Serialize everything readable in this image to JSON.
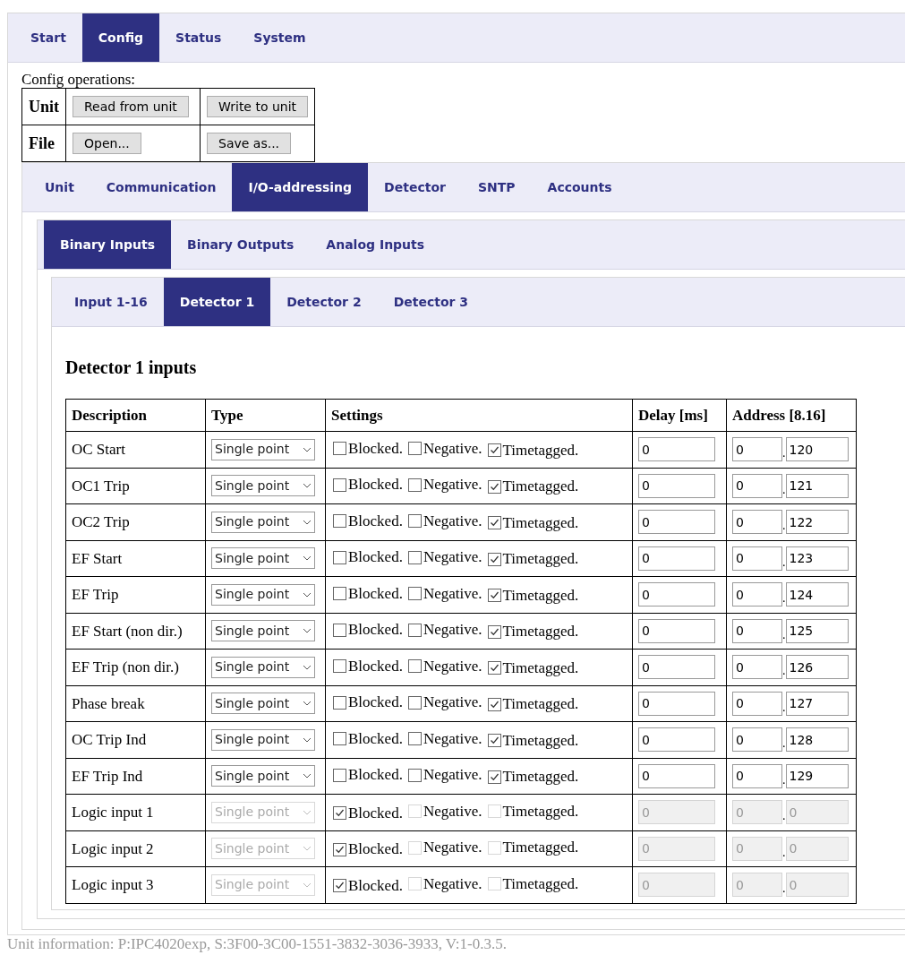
{
  "main_tabs": [
    {
      "label": "Start",
      "selected": false
    },
    {
      "label": "Config",
      "selected": true
    },
    {
      "label": "Status",
      "selected": false
    },
    {
      "label": "System",
      "selected": false
    }
  ],
  "config_operations": {
    "title": "Config operations:",
    "rows": [
      {
        "label": "Unit",
        "buttons": [
          "Read from unit",
          "Write to unit"
        ]
      },
      {
        "label": "File",
        "buttons": [
          "Open...",
          "Save as..."
        ]
      }
    ]
  },
  "config_tabs": [
    {
      "label": "Unit",
      "selected": false
    },
    {
      "label": "Communication",
      "selected": false
    },
    {
      "label": "I/O-addressing",
      "selected": true
    },
    {
      "label": "Detector",
      "selected": false
    },
    {
      "label": "SNTP",
      "selected": false
    },
    {
      "label": "Accounts",
      "selected": false
    }
  ],
  "io_tabs": [
    {
      "label": "Binary Inputs",
      "selected": true
    },
    {
      "label": "Binary Outputs",
      "selected": false
    },
    {
      "label": "Analog Inputs",
      "selected": false
    }
  ],
  "input_tabs": [
    {
      "label": "Input 1-16",
      "selected": false
    },
    {
      "label": "Detector 1",
      "selected": true
    },
    {
      "label": "Detector 2",
      "selected": false
    },
    {
      "label": "Detector 3",
      "selected": false
    }
  ],
  "section_title": "Detector 1 inputs",
  "table": {
    "columns": [
      "Description",
      "Type",
      "Settings",
      "Delay [ms]",
      "Address [8.16]"
    ],
    "rows": [
      {
        "description": "OC Start",
        "type": "Single point",
        "disabled": false,
        "settings": [
          {
            "label": "Blocked.",
            "checked": false,
            "disabled": false
          },
          {
            "label": "Negative.",
            "checked": false,
            "disabled": false
          },
          {
            "label": "Timetagged.",
            "checked": true,
            "disabled": false
          }
        ],
        "delay": "0",
        "address": {
          "high": "0",
          "separator": ".",
          "low": "120"
        }
      },
      {
        "description": "OC1 Trip",
        "type": "Single point",
        "disabled": false,
        "settings": [
          {
            "label": "Blocked.",
            "checked": false,
            "disabled": false
          },
          {
            "label": "Negative.",
            "checked": false,
            "disabled": false
          },
          {
            "label": "Timetagged.",
            "checked": true,
            "disabled": false
          }
        ],
        "delay": "0",
        "address": {
          "high": "0",
          "separator": ".",
          "low": "121"
        }
      },
      {
        "description": "OC2 Trip",
        "type": "Single point",
        "disabled": false,
        "settings": [
          {
            "label": "Blocked.",
            "checked": false,
            "disabled": false
          },
          {
            "label": "Negative.",
            "checked": false,
            "disabled": false
          },
          {
            "label": "Timetagged.",
            "checked": true,
            "disabled": false
          }
        ],
        "delay": "0",
        "address": {
          "high": "0",
          "separator": ".",
          "low": "122"
        }
      },
      {
        "description": "EF Start",
        "type": "Single point",
        "disabled": false,
        "settings": [
          {
            "label": "Blocked.",
            "checked": false,
            "disabled": false
          },
          {
            "label": "Negative.",
            "checked": false,
            "disabled": false
          },
          {
            "label": "Timetagged.",
            "checked": true,
            "disabled": false
          }
        ],
        "delay": "0",
        "address": {
          "high": "0",
          "separator": ".",
          "low": "123"
        }
      },
      {
        "description": "EF Trip",
        "type": "Single point",
        "disabled": false,
        "settings": [
          {
            "label": "Blocked.",
            "checked": false,
            "disabled": false
          },
          {
            "label": "Negative.",
            "checked": false,
            "disabled": false
          },
          {
            "label": "Timetagged.",
            "checked": true,
            "disabled": false
          }
        ],
        "delay": "0",
        "address": {
          "high": "0",
          "separator": ".",
          "low": "124"
        }
      },
      {
        "description": "EF Start (non dir.)",
        "type": "Single point",
        "disabled": false,
        "settings": [
          {
            "label": "Blocked.",
            "checked": false,
            "disabled": false
          },
          {
            "label": "Negative.",
            "checked": false,
            "disabled": false
          },
          {
            "label": "Timetagged.",
            "checked": true,
            "disabled": false
          }
        ],
        "delay": "0",
        "address": {
          "high": "0",
          "separator": ".",
          "low": "125"
        }
      },
      {
        "description": "EF Trip (non dir.)",
        "type": "Single point",
        "disabled": false,
        "settings": [
          {
            "label": "Blocked.",
            "checked": false,
            "disabled": false
          },
          {
            "label": "Negative.",
            "checked": false,
            "disabled": false
          },
          {
            "label": "Timetagged.",
            "checked": true,
            "disabled": false
          }
        ],
        "delay": "0",
        "address": {
          "high": "0",
          "separator": ".",
          "low": "126"
        }
      },
      {
        "description": "Phase break",
        "type": "Single point",
        "disabled": false,
        "settings": [
          {
            "label": "Blocked.",
            "checked": false,
            "disabled": false
          },
          {
            "label": "Negative.",
            "checked": false,
            "disabled": false
          },
          {
            "label": "Timetagged.",
            "checked": true,
            "disabled": false
          }
        ],
        "delay": "0",
        "address": {
          "high": "0",
          "separator": ".",
          "low": "127"
        }
      },
      {
        "description": "OC Trip Ind",
        "type": "Single point",
        "disabled": false,
        "settings": [
          {
            "label": "Blocked.",
            "checked": false,
            "disabled": false
          },
          {
            "label": "Negative.",
            "checked": false,
            "disabled": false
          },
          {
            "label": "Timetagged.",
            "checked": true,
            "disabled": false
          }
        ],
        "delay": "0",
        "address": {
          "high": "0",
          "separator": ".",
          "low": "128"
        }
      },
      {
        "description": "EF Trip Ind",
        "type": "Single point",
        "disabled": false,
        "settings": [
          {
            "label": "Blocked.",
            "checked": false,
            "disabled": false
          },
          {
            "label": "Negative.",
            "checked": false,
            "disabled": false
          },
          {
            "label": "Timetagged.",
            "checked": true,
            "disabled": false
          }
        ],
        "delay": "0",
        "address": {
          "high": "0",
          "separator": ".",
          "low": "129"
        }
      },
      {
        "description": "Logic input 1",
        "type": "Single point",
        "disabled": true,
        "settings": [
          {
            "label": "Blocked.",
            "checked": true,
            "disabled": false
          },
          {
            "label": "Negative.",
            "checked": false,
            "disabled": true
          },
          {
            "label": "Timetagged.",
            "checked": false,
            "disabled": true
          }
        ],
        "delay": "0",
        "address": {
          "high": "0",
          "separator": ".",
          "low": "0"
        }
      },
      {
        "description": "Logic input 2",
        "type": "Single point",
        "disabled": true,
        "settings": [
          {
            "label": "Blocked.",
            "checked": true,
            "disabled": false
          },
          {
            "label": "Negative.",
            "checked": false,
            "disabled": true
          },
          {
            "label": "Timetagged.",
            "checked": false,
            "disabled": true
          }
        ],
        "delay": "0",
        "address": {
          "high": "0",
          "separator": ".",
          "low": "0"
        }
      },
      {
        "description": "Logic input 3",
        "type": "Single point",
        "disabled": true,
        "settings": [
          {
            "label": "Blocked.",
            "checked": true,
            "disabled": false
          },
          {
            "label": "Negative.",
            "checked": false,
            "disabled": true
          },
          {
            "label": "Timetagged.",
            "checked": false,
            "disabled": true
          }
        ],
        "delay": "0",
        "address": {
          "high": "0",
          "separator": ".",
          "low": "0"
        }
      }
    ]
  },
  "footer": "Unit information: P:IPC4020exp, S:3F00-3C00-1551-3832-3036-3933, V:1-0.3.5."
}
